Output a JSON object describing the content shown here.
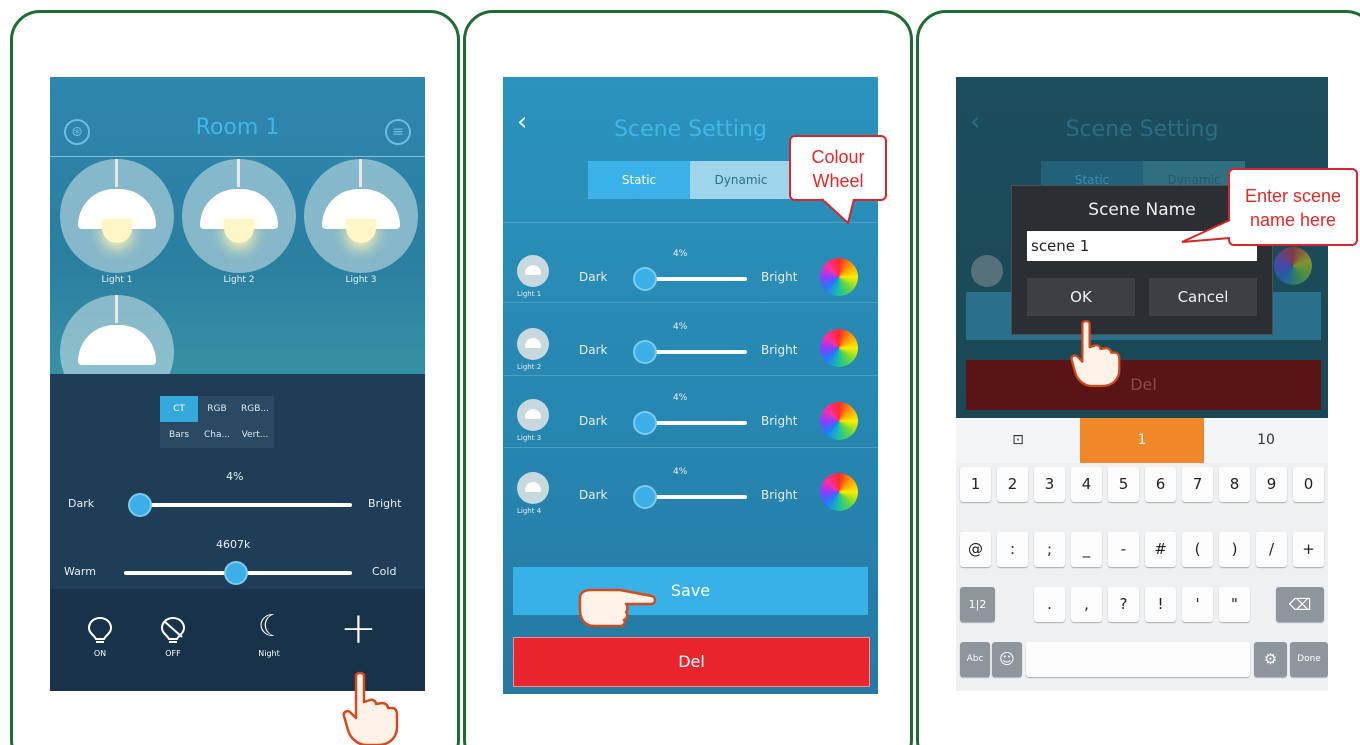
{
  "screen1": {
    "title": "Room 1",
    "lights": [
      "Light 1",
      "Light 2",
      "Light 3"
    ],
    "modes": [
      "CT",
      "RGB",
      "RGB...",
      "Bars",
      "Cha...",
      "Vert..."
    ],
    "brightness": {
      "value_label": "4%",
      "left": "Dark",
      "right": "Bright",
      "level": 0.04
    },
    "temperature": {
      "value_label": "4607k",
      "left": "Warm",
      "right": "Cold"
    },
    "bottom": {
      "on": "ON",
      "off": "OFF",
      "night": "Night"
    }
  },
  "screen2": {
    "title": "Scene Setting",
    "tab_static": "Static",
    "tab_dynamic": "Dynamic",
    "rows": [
      {
        "light": "Light 1",
        "percent": "4%",
        "left": "Dark",
        "right": "Bright"
      },
      {
        "light": "Light 2",
        "percent": "4%",
        "left": "Dark",
        "right": "Bright"
      },
      {
        "light": "Light 3",
        "percent": "4%",
        "left": "Dark",
        "right": "Bright"
      },
      {
        "light": "Light 4",
        "percent": "4%",
        "left": "Dark",
        "right": "Bright"
      }
    ],
    "save": "Save",
    "del": "Del"
  },
  "screen3": {
    "title": "Scene Setting",
    "tab_static": "Static",
    "tab_dynamic": "Dynamic",
    "dialog_title": "Scene Name",
    "input_value": "scene 1",
    "ok": "OK",
    "cancel": "Cancel",
    "del": "Del",
    "kb_top": [
      "1",
      "10"
    ],
    "row1": [
      "1",
      "2",
      "3",
      "4",
      "5",
      "6",
      "7",
      "8",
      "9",
      "0"
    ],
    "row2": [
      "@",
      ":",
      ";",
      "_",
      "-",
      "#",
      "(",
      ")",
      "/",
      "+"
    ],
    "row3": [
      ".",
      ",",
      "?",
      "!",
      "'",
      "\""
    ],
    "shift_label": "1|2",
    "abc": "Abc",
    "done": "Done"
  },
  "callouts": {
    "colour_wheel": "Colour\nWheel",
    "enter_name": "Enter scene\nname here"
  },
  "colors": {
    "frame": "#1e6b34",
    "accent": "#3ab2e8",
    "callout": "#d7262d",
    "del": "#e8252c",
    "key_orange": "#f0882a"
  }
}
